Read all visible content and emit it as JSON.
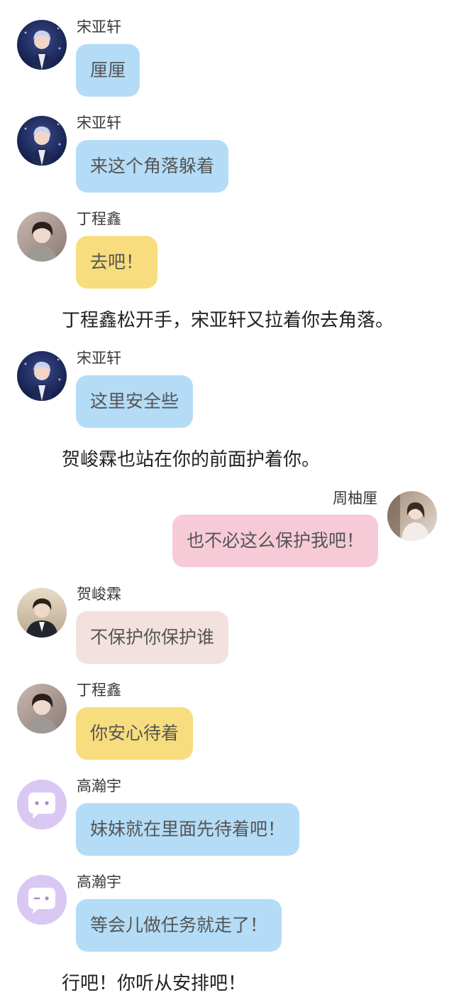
{
  "messages": [
    {
      "speaker": "宋亚轩",
      "text": "厘厘",
      "avatar_icon": "song-yaxuan-avatar-icon"
    },
    {
      "speaker": "宋亚轩",
      "text": "来这个角落躲着",
      "avatar_icon": "song-yaxuan-avatar-icon"
    },
    {
      "speaker": "丁程鑫",
      "text": "去吧！",
      "avatar_icon": "ding-chengxin-avatar-icon"
    },
    {
      "speaker": "宋亚轩",
      "text": "这里安全些",
      "avatar_icon": "song-yaxuan-avatar-icon"
    },
    {
      "speaker": "周柚厘",
      "text": "也不必这么保护我吧！",
      "avatar_icon": "zhou-youli-avatar-icon"
    },
    {
      "speaker": "贺峻霖",
      "text": "不保护你保护谁",
      "avatar_icon": "he-junlin-avatar-icon"
    },
    {
      "speaker": "丁程鑫",
      "text": "你安心待着",
      "avatar_icon": "ding-chengxin-avatar-icon"
    },
    {
      "speaker": "高瀚宇",
      "text": "妹妹就在里面先待着吧！",
      "avatar_icon": "chat-bubble-face-icon"
    },
    {
      "speaker": "高瀚宇",
      "text": "等会儿做任务就走了！",
      "avatar_icon": "chat-bubble-face-icon"
    }
  ],
  "narrations": [
    "丁程鑫松开手，宋亚轩又拉着你去角落。",
    "贺峻霖也站在你的前面护着你。",
    "行吧！你听从安排吧！"
  ],
  "colors": {
    "bubble_blue": "#b4dcf6",
    "bubble_yellow": "#f8dd7e",
    "bubble_pink": "#f6cbd7",
    "bubble_beige": "#f2e1df",
    "placeholder_avatar": "#d9c8f4"
  }
}
